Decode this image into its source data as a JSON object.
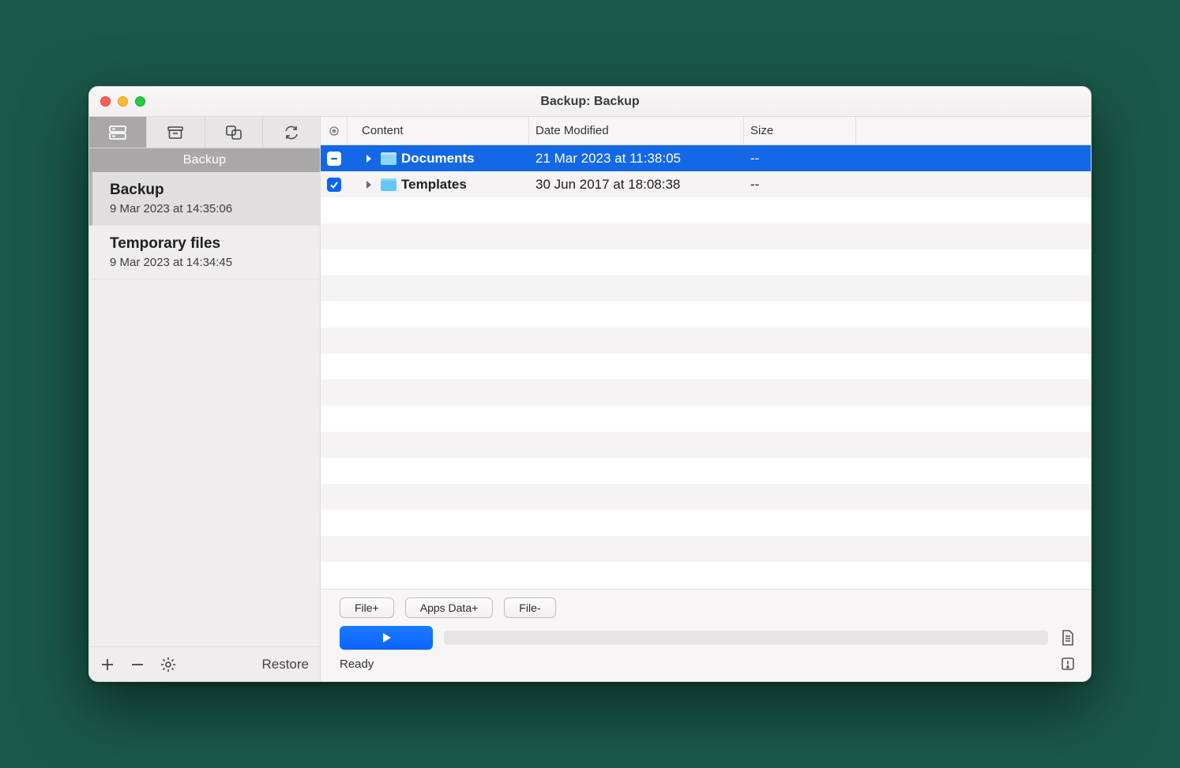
{
  "window": {
    "title": "Backup: Backup"
  },
  "sidebar": {
    "header": "Backup",
    "items": [
      {
        "name": "Backup",
        "date": "9 Mar 2023 at 14:35:06"
      },
      {
        "name": "Temporary files",
        "date": "9 Mar 2023 at 14:34:45"
      }
    ],
    "footer": {
      "restore": "Restore"
    }
  },
  "columns": {
    "content": "Content",
    "date": "Date Modified",
    "size": "Size"
  },
  "rows": [
    {
      "name": "Documents",
      "date": "21 Mar 2023 at 11:38:05",
      "size": "--",
      "check": "mixed",
      "selected": true
    },
    {
      "name": "Templates",
      "date": "30 Jun 2017 at 18:08:38",
      "size": "--",
      "check": "checked",
      "selected": false
    }
  ],
  "buttons": {
    "file_add": "File+",
    "apps_data": "Apps Data+",
    "file_remove": "File-"
  },
  "status": "Ready"
}
